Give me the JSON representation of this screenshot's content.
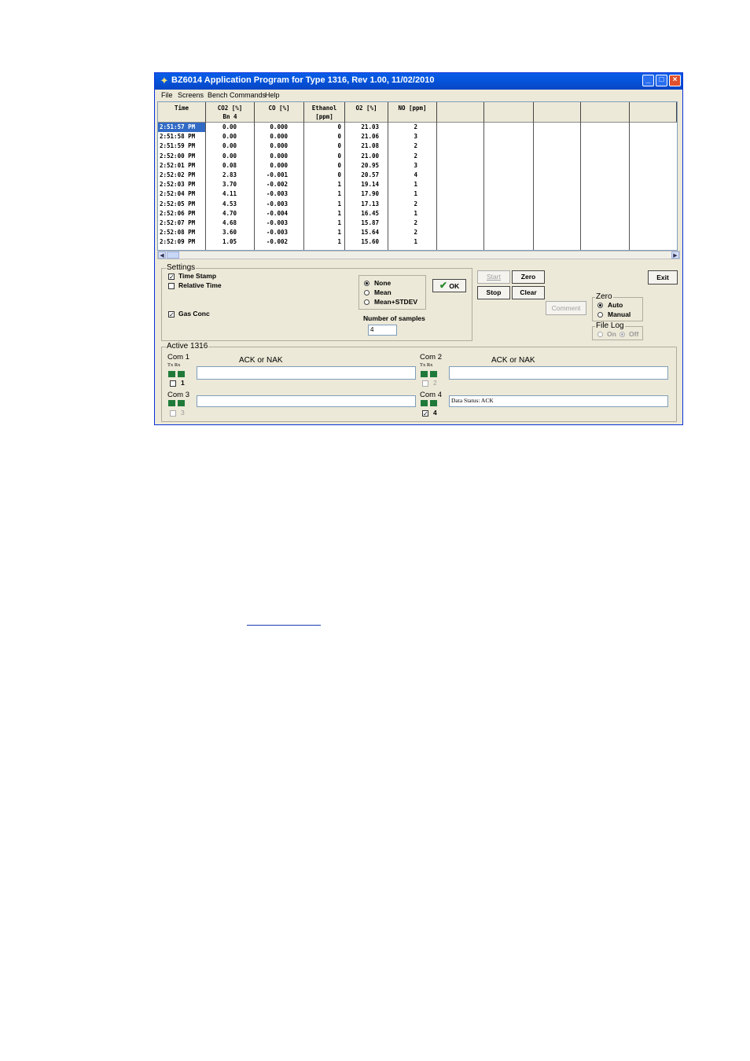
{
  "window": {
    "title": "BZ6014 Application Program for Type 1316, Rev 1.00, 11/02/2010",
    "buttons": {
      "minimize": "_",
      "maximize": "□",
      "close": "×"
    }
  },
  "menu": [
    "File",
    "Screens",
    "Bench Commands",
    "Help"
  ],
  "grid": {
    "columns": [
      {
        "line1": "Time",
        "line2": ""
      },
      {
        "line1": "CO2 [%]",
        "line2": "Bn 4"
      },
      {
        "line1": "CO [%]",
        "line2": ""
      },
      {
        "line1": "Ethanol",
        "line2": "[ppm]"
      },
      {
        "line1": "O2 [%]",
        "line2": ""
      },
      {
        "line1": "NO [ppm]",
        "line2": ""
      },
      {
        "line1": "",
        "line2": ""
      },
      {
        "line1": "",
        "line2": ""
      },
      {
        "line1": "",
        "line2": ""
      },
      {
        "line1": "",
        "line2": ""
      },
      {
        "line1": "",
        "line2": ""
      }
    ],
    "rows": [
      [
        "2:51:57 PM",
        "0.00",
        "0.000",
        "0",
        "21.03",
        "2"
      ],
      [
        "2:51:58 PM",
        "0.00",
        "0.000",
        "0",
        "21.06",
        "3"
      ],
      [
        "2:51:59 PM",
        "0.00",
        "0.000",
        "0",
        "21.08",
        "2"
      ],
      [
        "2:52:00 PM",
        "0.00",
        "0.000",
        "0",
        "21.00",
        "2"
      ],
      [
        "2:52:01 PM",
        "0.08",
        "0.000",
        "0",
        "20.95",
        "3"
      ],
      [
        "2:52:02 PM",
        "2.83",
        "-0.001",
        "0",
        "20.57",
        "4"
      ],
      [
        "2:52:03 PM",
        "3.70",
        "-0.002",
        "1",
        "19.14",
        "1"
      ],
      [
        "2:52:04 PM",
        "4.11",
        "-0.003",
        "1",
        "17.90",
        "1"
      ],
      [
        "2:52:05 PM",
        "4.53",
        "-0.003",
        "1",
        "17.13",
        "2"
      ],
      [
        "2:52:06 PM",
        "4.70",
        "-0.004",
        "1",
        "16.45",
        "1"
      ],
      [
        "2:52:07 PM",
        "4.68",
        "-0.003",
        "1",
        "15.87",
        "2"
      ],
      [
        "2:52:08 PM",
        "3.60",
        "-0.003",
        "1",
        "15.64",
        "2"
      ],
      [
        "2:52:09 PM",
        "1.05",
        "-0.002",
        "1",
        "15.60",
        "1"
      ]
    ]
  },
  "settings": {
    "title": "Settings",
    "time_stamp": {
      "label": "Time Stamp",
      "checked": true
    },
    "relative_time": {
      "label": "Relative Time",
      "checked": false
    },
    "gas_conc": {
      "label": "Gas Conc",
      "checked": true
    },
    "stats": {
      "options": [
        "None",
        "Mean",
        "Mean+STDEV"
      ],
      "selected": "None"
    },
    "ok_label": "OK",
    "num_samples_label": "Number of samples",
    "num_samples_value": "4"
  },
  "controls": {
    "start": "Start",
    "zero": "Zero",
    "stop": "Stop",
    "clear": "Clear",
    "comment": "Comment",
    "exit": "Exit"
  },
  "zero_group": {
    "title": "Zero",
    "options": [
      "Auto",
      "Manual"
    ],
    "selected": "Auto"
  },
  "file_log": {
    "title": "File Log",
    "on": "On",
    "off": "Off",
    "selected": "Off"
  },
  "active": {
    "title": "Active 1316",
    "txrx": "Tx Rx",
    "ack_label": "ACK or NAK",
    "coms": [
      {
        "label": "Com 1",
        "check_label": "1",
        "checked": false,
        "enabled": true,
        "status": ""
      },
      {
        "label": "Com 2",
        "check_label": "2",
        "checked": false,
        "enabled": false,
        "status": ""
      },
      {
        "label": "Com 3",
        "check_label": "3",
        "checked": false,
        "enabled": false,
        "status": ""
      },
      {
        "label": "Com 4",
        "check_label": "4",
        "checked": true,
        "enabled": true,
        "status": "Data Status: ACK"
      }
    ]
  },
  "colors": {
    "led": "#1f7a3a",
    "titlebar": "#0553d9",
    "selected_row": "#316ac5"
  }
}
